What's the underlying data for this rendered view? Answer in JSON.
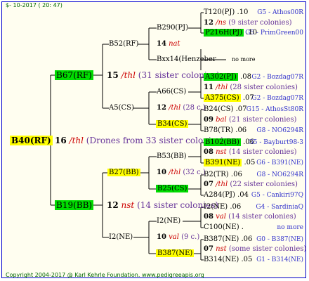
{
  "date": "$- 10-2017 ( 20: 47)",
  "root": {
    "id": "B40(RF)",
    "gen": "16",
    "mark": "/thl",
    "info": "(Drones from 33 sister colonies)"
  },
  "a1": {
    "id": "B67(RF)",
    "gen": "15",
    "mark": "/thl",
    "info": "(31 sister colonies)"
  },
  "a2": {
    "id": "B19(BB)",
    "gen": "12",
    "mark": "nst",
    "info": "(14 sister colonies)"
  },
  "b1": {
    "id": "B52(RF)"
  },
  "b2": {
    "id": "A5(CS)",
    "gen": "12",
    "mark": "/thl",
    "info": "(28 c.)"
  },
  "b3": {
    "id": "B27(BB)",
    "gen": "10",
    "mark": "/thl",
    "info": "(32 c.)"
  },
  "b4": {
    "id": "I2(NE)",
    "gen": "10",
    "mark": "val",
    "info": "(9 c.)"
  },
  "c1": {
    "id": "B290(PJ)",
    "gen": "14",
    "mark": "nat"
  },
  "c2": {
    "id": "Bxx14(Henzeber",
    "extra": "no more"
  },
  "c3": {
    "id": "A66(CS)"
  },
  "c4": {
    "id": "B34(CS)"
  },
  "c5": {
    "id": "B53(BB)"
  },
  "c6": {
    "id": "B25(CS)"
  },
  "c7": {
    "id": "I2(NE)"
  },
  "c8": {
    "id": "B387(NE)"
  },
  "d": [
    {
      "text": "T120(PJ)",
      "num": ".10",
      "right": "G5 - Athos00R",
      "hl": ""
    },
    {
      "text": "12",
      "mark": "/ns",
      "info": "(9 sister colonies)",
      "hl": ""
    },
    {
      "text": "P216H(PJ)",
      "num": ".10",
      "right": "G5 - PrimGreen00",
      "hl": "green"
    },
    {
      "text": "A302(PJ)",
      "num": ".08",
      "right": "G2 - Bozdag07R",
      "hl": "green"
    },
    {
      "text": "11",
      "mark": "/thl",
      "info": "(28 sister colonies)",
      "hl": ""
    },
    {
      "text": "A375(CS)",
      "num": ".07",
      "right": "G2 - Bozdag07R",
      "hl": "yellow"
    },
    {
      "text": "B24(CS)",
      "num": ".07",
      "right": "G15 - AthosSt80R",
      "hl": ""
    },
    {
      "text": "09",
      "mark": "bal",
      "info": "(21 sister colonies)",
      "hl": ""
    },
    {
      "text": "B78(TR)",
      "num": ".06",
      "right": "G8 - NO6294R",
      "hl": ""
    },
    {
      "text": "B102(BB)",
      "num": ".06",
      "right": "G5 - Bayburt98-3",
      "hl": "green"
    },
    {
      "text": "08",
      "mark": "nst",
      "info": "(14 sister colonies)",
      "hl": ""
    },
    {
      "text": "B391(NE)",
      "num": ".05",
      "right": "G6 - B391(NE)",
      "hl": "yellow"
    },
    {
      "text": "B2(TR)",
      "num": ".06",
      "right": "G8 - NO6294R",
      "hl": ""
    },
    {
      "text": "07",
      "mark": "/thl",
      "info": "(22 sister colonies)",
      "hl": ""
    },
    {
      "text": "A284(PJ)",
      "num": ".04",
      "right": "G5 - Cankiri97Q",
      "hl": ""
    },
    {
      "text": "I2(NE)",
      "num": ".06",
      "right": "G4 - SardiniaQ",
      "hl": ""
    },
    {
      "text": "08",
      "mark": "val",
      "info": "(14 sister colonies)",
      "hl": ""
    },
    {
      "text": "C100(NE)",
      "num": ".",
      "right": "no more",
      "hl": ""
    },
    {
      "text": "B387(NE)",
      "num": ".06",
      "right": "G0 - B387(NE)",
      "hl": ""
    },
    {
      "text": "07",
      "mark": "nst",
      "info": "(some sister colonies)",
      "hl": ""
    },
    {
      "text": "B314(NE)",
      "num": ".05",
      "right": "G1 - B314(NE)",
      "hl": ""
    }
  ],
  "footer": "Copyright 2004-2017 @ Karl Kehrle Foundation.   www.pedigreeapis.org",
  "colors": {
    "green": "#00dd00",
    "yellow": "#ffff00",
    "line": "#000000"
  }
}
